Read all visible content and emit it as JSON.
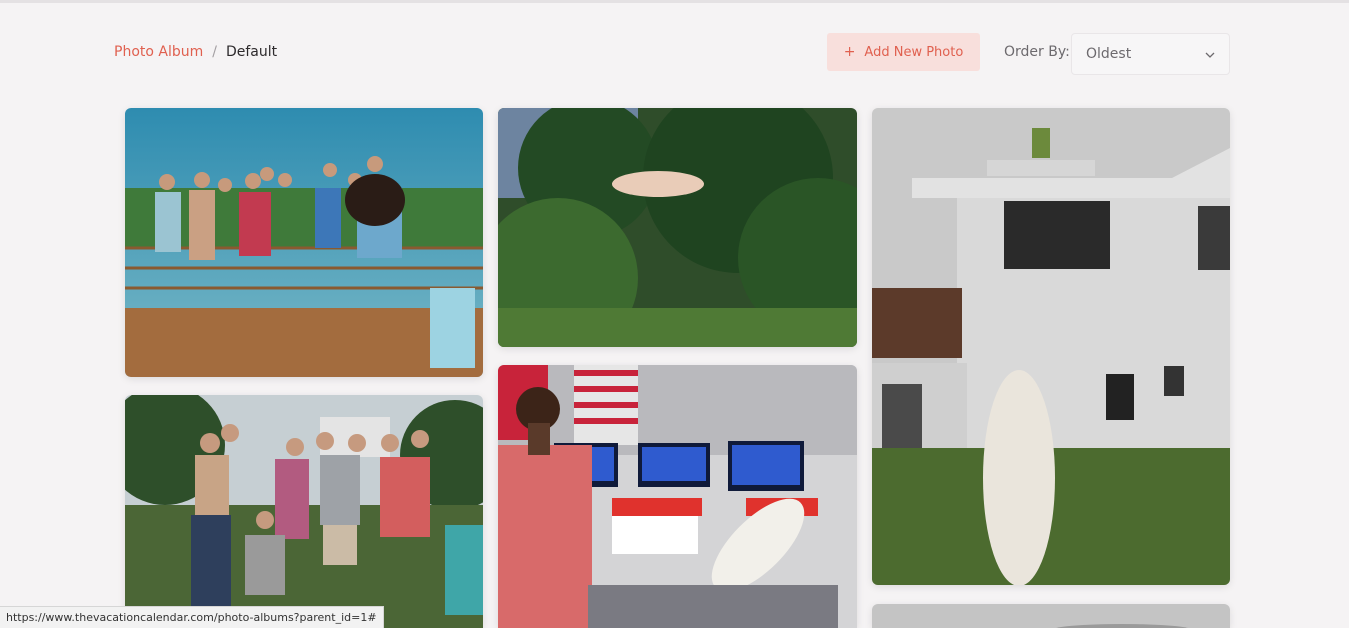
{
  "breadcrumb": {
    "root": "Photo Album",
    "separator": "/",
    "current": "Default"
  },
  "toolbar": {
    "add_photo_label": "Add New Photo",
    "add_icon": "+",
    "order_by_label": "Order By:",
    "order_by_value": "Oldest"
  },
  "photos": [
    "group-on-deck-with-dog",
    "trees-with-surfboard",
    "house-with-surfboard",
    "group-outdoors",
    "walmart-rollback-aisle",
    "photo-partial"
  ],
  "status_bar": {
    "url": "https://www.thevacationcalendar.com/photo-albums?parent_id=1#"
  },
  "colors": {
    "accent": "#e0604f",
    "accent_bg": "#f8dfdc",
    "page_bg": "#f5f3f4"
  }
}
